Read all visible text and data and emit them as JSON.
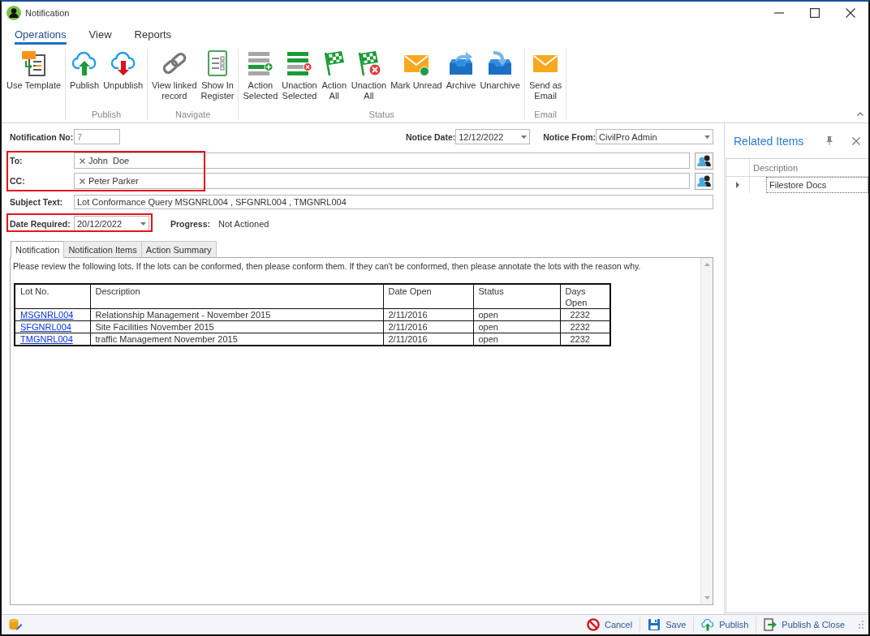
{
  "window": {
    "title": "Notification"
  },
  "ribbon": {
    "tabs": [
      {
        "label": "Operations",
        "selected": true
      },
      {
        "label": "View",
        "selected": false
      },
      {
        "label": "Reports",
        "selected": false
      }
    ],
    "groups": [
      {
        "buttons": [
          {
            "kind": "use-template",
            "label": "Use Template"
          }
        ]
      },
      {
        "label": "Publish",
        "buttons": [
          {
            "kind": "publish",
            "label": "Publish"
          },
          {
            "kind": "unpublish",
            "label": "Unpublish"
          }
        ]
      },
      {
        "label": "Navigate",
        "buttons": [
          {
            "kind": "view-linked",
            "label": "View linked\nrecord"
          },
          {
            "kind": "show-register",
            "label": "Show In\nRegister"
          }
        ]
      },
      {
        "label": "Status",
        "buttons": [
          {
            "kind": "action-selected",
            "label": "Action\nSelected"
          },
          {
            "kind": "unaction-selected",
            "label": "Unaction\nSelected"
          },
          {
            "kind": "action-all",
            "label": "Action\nAll"
          },
          {
            "kind": "unaction-all",
            "label": "Unaction\nAll"
          },
          {
            "kind": "mark-unread",
            "label": "Mark Unread"
          },
          {
            "kind": "archive",
            "label": "Archive"
          },
          {
            "kind": "unarchive",
            "label": "Unarchive"
          }
        ]
      },
      {
        "label": "Email",
        "buttons": [
          {
            "kind": "send-email",
            "label": "Send as\nEmail"
          }
        ]
      }
    ]
  },
  "form": {
    "notification_no": {
      "label": "Notification No:",
      "value": "7",
      "read_only": true
    },
    "notice_date": {
      "label": "Notice Date:",
      "value": "12/12/2022"
    },
    "notice_from": {
      "label": "Notice From:",
      "value": "CivilPro Admin"
    },
    "recipients": {
      "highlighted": true,
      "to": {
        "label": "To:",
        "tags": [
          "John  Doe"
        ]
      },
      "cc": {
        "label": "CC:",
        "tags": [
          "Peter Parker"
        ]
      }
    },
    "subject": {
      "label": "Subject Text:",
      "value": "Lot Conformance Query MSGNRL004 , SFGNRL004 , TMGNRL004"
    },
    "date_required": {
      "label": "Date Required:",
      "value": "20/12/2022",
      "highlighted": true
    },
    "progress": {
      "label": "Progress:",
      "value": "Not Actioned"
    }
  },
  "detail_tabs": [
    {
      "label": "Notification",
      "selected": true
    },
    {
      "label": "Notification Items",
      "selected": false
    },
    {
      "label": "Action Summary",
      "selected": false
    }
  ],
  "message": "Please review the following lots. If the lots can be conformed, then please conform them. If they can't be conformed, then please annotate the lots with the reason why.",
  "lots_table": {
    "columns": [
      "Lot No.",
      "Description",
      "Date Open",
      "Status",
      "Days\nOpen"
    ],
    "rows": [
      {
        "lot_no": "MSGNRL004",
        "description": "Relationship Management - November 2015",
        "date_open": "2/11/2016",
        "status": "open",
        "days_open": "2232"
      },
      {
        "lot_no": "SFGNRL004",
        "description": "Site Facilities November 2015",
        "date_open": "2/11/2016",
        "status": "open",
        "days_open": "2232"
      },
      {
        "lot_no": "TMGNRL004",
        "description": "traffic Management November 2015",
        "date_open": "2/11/2016",
        "status": "open",
        "days_open": "2232"
      }
    ]
  },
  "related_items": {
    "title": "Related Items",
    "columns": [
      "Description"
    ],
    "rows": [
      {
        "label": "Filestore Docs",
        "expanded": false,
        "selected": true
      }
    ]
  },
  "footer": {
    "buttons": [
      {
        "kind": "cancel",
        "label": "Cancel"
      },
      {
        "kind": "save",
        "label": "Save"
      },
      {
        "kind": "publish",
        "label": "Publish"
      },
      {
        "kind": "publish-close",
        "label": "Publish & Close"
      }
    ]
  }
}
